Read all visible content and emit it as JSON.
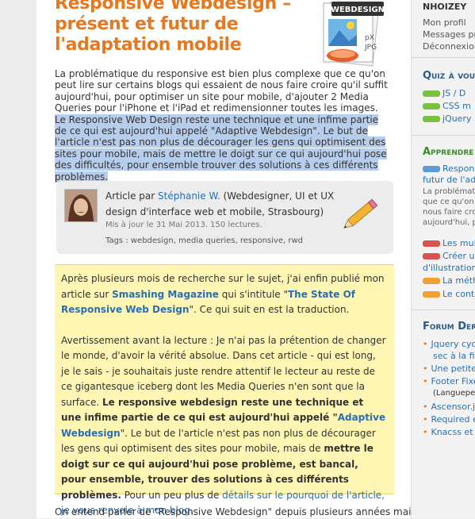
{
  "article": {
    "title": "Responsive Webdesign – présent et futur de l'adaptation mobile",
    "badge_label": "WEBDESIGN",
    "badge_sub1": "pX",
    "badge_sub2": "JPG",
    "intro_plain": "La problématique du responsive est bien plus complexe que ce qu'on peut lire sur certains blogs qui essaient de nous faire croire qu'il suffit aujourd'hui, pour optimiser un site pour mobile, d'ajouter 2 Media Queries pour l'iPhone et l'iPad et redimensionner toutes les images. ",
    "intro_highlight": "Le Responsive Web Design reste une technique et une infime partie de ce qui est aujourd'hui appelé \"Adaptive Webdesign\". Le but de l'article n'est pas non plus de décourager les gens qui optimisent des sites pour mobile, mais de mettre le doigt sur ce qui aujourd'hui pose des difficultés, pour ensemble trouver des solutions à ces différents problèmes.",
    "author_prefix": "Article par ",
    "author_name": "Stéphanie W.",
    "author_desc": " (Webdesigner, UI et UX design d'interface web et mobile, Strasbourg)",
    "updated": "Mis à jour le 31 Mai 2013. 150 lectures.",
    "tags_prefix": "Tags : ",
    "tags": "webdesign, media queries, responsive, rwd",
    "note": {
      "p1_a": "Après plusieurs mois de recherche sur le sujet, j'ai enfin publié mon article sur ",
      "p1_link1": "Smashing Magazine",
      "p1_b": " qui s'intitule \"",
      "p1_link2": "The State Of Responsive Web Design",
      "p1_c": "\". Ce qui suit en est la traduction.",
      "p2_a": "Avertissement avant la lecture : Je n'ai pas la prétention de changer le monde, d'avoir la vérité absolue. Dans cet article - qui est long, je le sais - je souhaitais juste rendre attentif le lecteur au reste de ce gigantesque iceberg dont les Media Queries n'en sont que la surface. ",
      "p2_bold1": "Le responsive webdesign reste une technique et une infime partie de ce qui est aujourd'hui appelé \"",
      "p2_link1": "Adaptive Webdesign",
      "p2_b": "\". Le but de l'article n'est pas non plus de décourager les gens qui optimisent des sites pour mobile, mais de ",
      "p2_bold2": "mettre le doigt sur ce qui aujourd'hui pose problème, est bancal, pour ensemble, trouver des solutions à ces différents problèmes.",
      "p2_c": " Pour un peu plus de ",
      "p2_link2": "détails sur le pourquoi de l'article, je vous renvoie à mon blog",
      "p2_d": "."
    },
    "bottom_text": "On entend parler de \"Responsive Webdesign\" depuis plusieurs années maintenant,"
  },
  "sidebar": {
    "username": "NHOIZEY",
    "links": [
      "Mon profil",
      "Messages priv",
      "Déconnexion"
    ],
    "quiz_title": "Quiz à vous",
    "quiz_items": [
      "JS / D",
      "CSS m",
      "jQuery"
    ],
    "learn_title": "Apprendre",
    "learn_feature_title1": "Respons",
    "learn_feature_title2": "futur de l'ada",
    "learn_feature_text": [
      "La problémati",
      "que ce qu'on p",
      "nous faire croi",
      "aujourd'hui, p"
    ],
    "learn_items": [
      "Les mult",
      "Créer un",
      "d'illustration",
      "La méth",
      "Le conte"
    ],
    "forum_title": "Forum Dern",
    "forum_items": [
      "Jquery cyc",
      "sec à la fir",
      "Une petite",
      "Footer Fixe",
      "(Languepen",
      "Ascensor.j",
      "Required e",
      "Knacss et C"
    ]
  },
  "colors": {
    "title": "#e8781e",
    "link": "#2a6fb3",
    "highlight": "#b7cdec",
    "note_bg": "#fff6b3"
  }
}
